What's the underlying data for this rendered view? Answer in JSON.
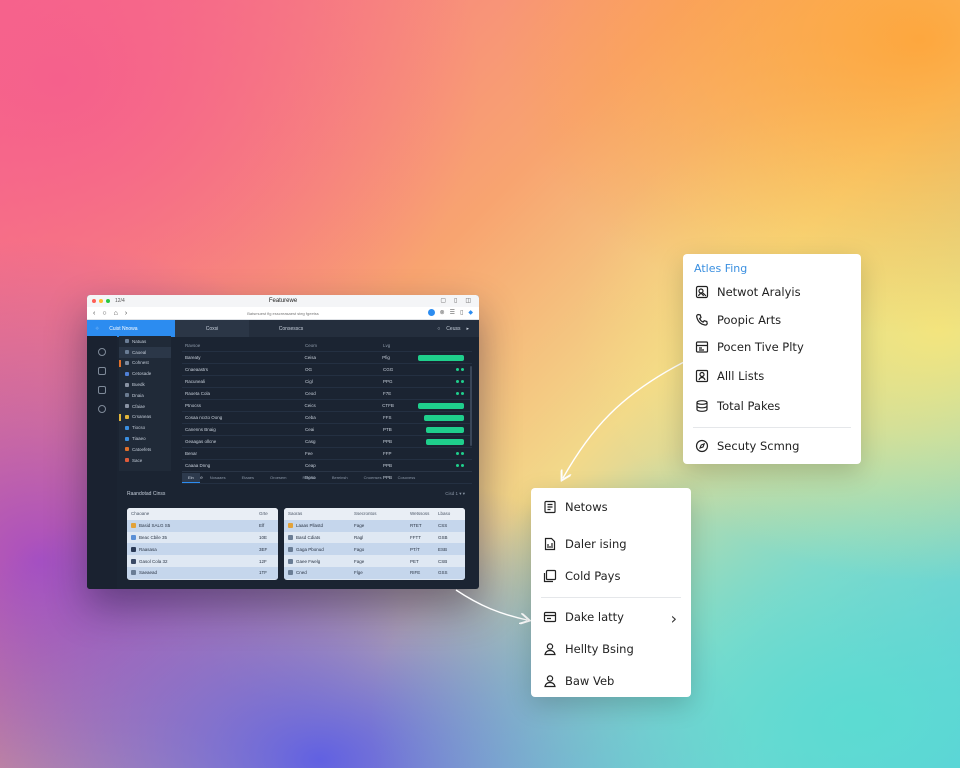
{
  "window": {
    "title": "Featurewe",
    "left_label": "12/4",
    "url": "Batsmuest fig esscreasaest steg fgeetss"
  },
  "tabs": [
    {
      "label": "Cuist Nnowa"
    },
    {
      "label": "Coxsi"
    },
    {
      "label": "Consesscs"
    }
  ],
  "tab_right_label": "Ceuss",
  "sidebar": {
    "items": [
      {
        "label": "Natuas",
        "color": "#6a7d95"
      },
      {
        "label": "Caoeal",
        "color": "#6a7d95"
      },
      {
        "label": "Cohnest",
        "color": "#7b8aa0"
      },
      {
        "label": "Cetosade",
        "color": "#4f7fd6"
      },
      {
        "label": "Buedk",
        "color": "#8a93a3"
      },
      {
        "label": "Dnaia",
        "color": "#6b7b90"
      },
      {
        "label": "Cfaiae",
        "color": "#8a93a3"
      },
      {
        "label": "Crsaneas",
        "color": "#e2b63a"
      },
      {
        "label": "Tiocso",
        "color": "#3a8fe0"
      },
      {
        "label": "Tiaaeo",
        "color": "#3a8fe0"
      },
      {
        "label": "Catoefets",
        "color": "#e0702b"
      },
      {
        "label": "Sace",
        "color": "#e05a3a"
      }
    ]
  },
  "main_table": {
    "headers": [
      "Ravsoe",
      "Ceom",
      "Lvg"
    ],
    "rows": [
      [
        "Bareaty",
        "Ceisa",
        "Pfig",
        "pill"
      ],
      [
        "Cnaeaastrs",
        "OG",
        "CGG",
        "dots"
      ],
      [
        "Racuneali",
        "Cigl",
        "PPG",
        "dots"
      ],
      [
        "Raoeta Cola",
        "Ceod",
        "F7E",
        "dots"
      ],
      [
        "Ptnocss",
        "Ceics",
        "CTFB",
        "pill"
      ],
      [
        "Cosaa nccto Oong",
        "Ceba",
        "FFS",
        "pill"
      ],
      [
        "Canenns Bnaig",
        "Ceai",
        "PTB",
        "pill"
      ],
      [
        "Geaagas ollcne",
        "Casg",
        "PPB",
        "pill"
      ],
      [
        "Benar",
        "Fee",
        "FFP",
        "dots"
      ],
      [
        "Caaaa Dnng",
        "Ceap",
        "PPB",
        "dots"
      ],
      [
        "Wlaedge",
        "Doso",
        "PPB",
        ""
      ]
    ]
  },
  "bottom_tabs": [
    "Eln",
    "Nosaaes",
    "Etaaes",
    "Oroesem",
    "Ragcsc",
    "Bereinsh",
    "Cnoenses",
    "Cosovess"
  ],
  "lower": {
    "title": "Raandotad Cinss",
    "right": "Cisd 1"
  },
  "table_a": {
    "headers": [
      "Chaoane",
      "Grte"
    ],
    "rows": [
      {
        "name": "Basid SALG S5",
        "val": "Elf",
        "icon": "#e2a23a"
      },
      {
        "name": "Beac Cbile 35",
        "val": "10E",
        "icon": "#5a8fd6"
      },
      {
        "name": "Raasasa",
        "val": "3EF",
        "icon": "#2a3a56"
      },
      {
        "name": "Gasol Cola 32",
        "val": "12F",
        "icon": "#3a4a66"
      },
      {
        "name": "Saeaead",
        "val": "1TF",
        "icon": "#6a7d95"
      }
    ]
  },
  "table_b": {
    "headers": [
      "Saoras",
      "Ssecrontos",
      "Wetssoss",
      "Lbaso"
    ],
    "rows": [
      {
        "name": "Laaas Pllastd",
        "c2": "Fage",
        "c3": "RTET",
        "c4": "CSS",
        "icon": "#e2a23a"
      },
      {
        "name": "Basd Cdiats",
        "c2": "Ragl",
        "c3": "FFTT",
        "c4": "GSB",
        "icon": "#6a7d95"
      },
      {
        "name": "Gaga Pbonud",
        "c2": "Fago",
        "c3": "PT/T",
        "c4": "ESB",
        "icon": "#6a7d95"
      },
      {
        "name": "Gaee Fwelg",
        "c2": "Fage",
        "c3": "PET",
        "c4": "CSB",
        "icon": "#6a7d95"
      },
      {
        "name": "Cned",
        "c2": "Flge",
        "c3": "RIFE",
        "c4": "GSS",
        "icon": "#6a7d95"
      }
    ]
  },
  "menu1": {
    "heading": "Atles Fing",
    "items": [
      {
        "label": "Netwot Aralyis",
        "icon": "user-search-icon"
      },
      {
        "label": "Poopic Arts",
        "icon": "phone-icon"
      },
      {
        "label": "Pocen Tive Plty",
        "icon": "image-icon"
      },
      {
        "label": "Alll Lists",
        "icon": "user-list-icon"
      },
      {
        "label": "Total Pakes",
        "icon": "database-icon"
      },
      {
        "label": "Secuty Scmng",
        "icon": "compass-icon"
      }
    ]
  },
  "menu2": {
    "items": [
      {
        "label": "Netows",
        "icon": "document-icon"
      },
      {
        "label": "Daler ising",
        "icon": "file-icon"
      },
      {
        "label": "Cold Pays",
        "icon": "copy-icon"
      },
      {
        "label": "Dake latty",
        "icon": "card-icon"
      },
      {
        "label": "Hellty Bsing",
        "icon": "user-icon"
      },
      {
        "label": "Baw Veb",
        "icon": "user-icon"
      }
    ]
  }
}
